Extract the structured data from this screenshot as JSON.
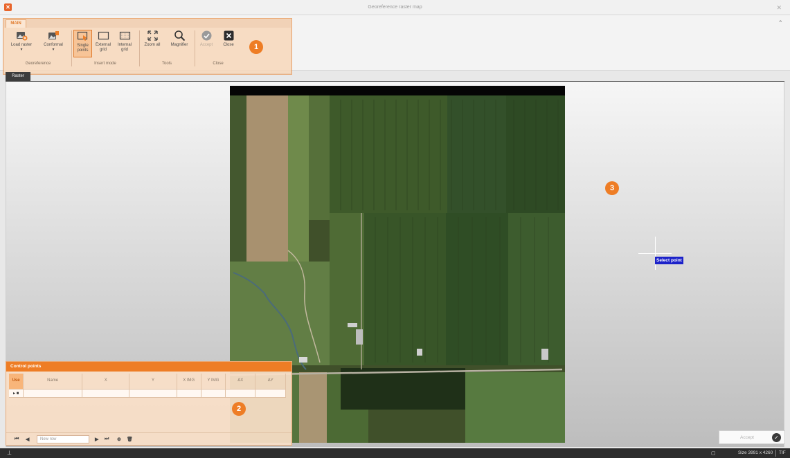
{
  "window": {
    "title": "Georeference raster map"
  },
  "ribbon": {
    "tab": "MAIN",
    "groups": [
      {
        "label": "Georeference",
        "buttons": [
          {
            "label": "Load raster"
          },
          {
            "label": "Conformal"
          }
        ]
      },
      {
        "label": "Insert mode",
        "buttons": [
          {
            "label": "Single points"
          },
          {
            "label": "External grid"
          },
          {
            "label": "Internal grid"
          }
        ]
      },
      {
        "label": "Tools",
        "buttons": [
          {
            "label": "Zoom all"
          },
          {
            "label": "Magnifier"
          }
        ]
      },
      {
        "label": "Close",
        "buttons": [
          {
            "label": "Accept"
          },
          {
            "label": "Close"
          }
        ]
      }
    ]
  },
  "callouts": [
    "1",
    "2",
    "3"
  ],
  "document_tab": "Raster",
  "canvas": {
    "tooltip": "Select point"
  },
  "control_points": {
    "title": "Control points",
    "columns": [
      "Use",
      "Name",
      "X",
      "Y",
      "X IMG",
      "Y IMG",
      "ΔX",
      "ΔY"
    ],
    "new_row_placeholder": "New row"
  },
  "accept_button": "Accept",
  "status": {
    "size": "Size 3991 x 4260",
    "format": "TIF"
  },
  "colors": {
    "accent": "#ee7d25",
    "tooltip": "#1c22c9",
    "statusbar": "#2d2d2d"
  }
}
